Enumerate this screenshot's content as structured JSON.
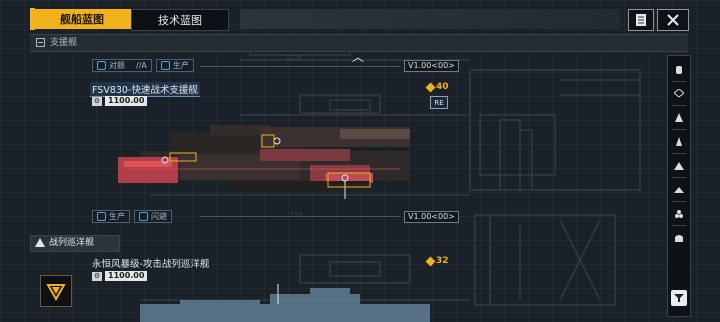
{
  "tabs": [
    {
      "label": "舰船蓝图",
      "active": true
    },
    {
      "label": "技术蓝图",
      "active": false
    }
  ],
  "category": {
    "label": "支援舰"
  },
  "ships": [
    {
      "status_left": [
        "对舰",
        "//A"
      ],
      "status_right": "生产",
      "version": "V1.00<00>"
    },
    {
      "title": "FSV830-快速战术支援舰",
      "cost": "1100.00",
      "count": "40",
      "tag": "RE",
      "status": [
        "生产",
        "闪避"
      ],
      "version": "V1.00<00>"
    }
  ],
  "section2": {
    "label": "战列巡洋舰"
  },
  "ship3": {
    "title": "永恒风暴级-攻击战列巡洋舰",
    "cost": "1100.00",
    "count": "32"
  },
  "colors": {
    "accent": "#f2b21b",
    "ship_highlight": "#e0525b",
    "blueprint": "#6c7c8c"
  },
  "rail_icons": [
    "ship-class-1-icon",
    "ship-class-2-icon",
    "ship-class-3-icon",
    "ship-class-4-icon",
    "ship-class-5-icon",
    "ship-class-6-icon",
    "ship-class-7-icon",
    "ship-class-8-icon",
    "filter-icon"
  ]
}
